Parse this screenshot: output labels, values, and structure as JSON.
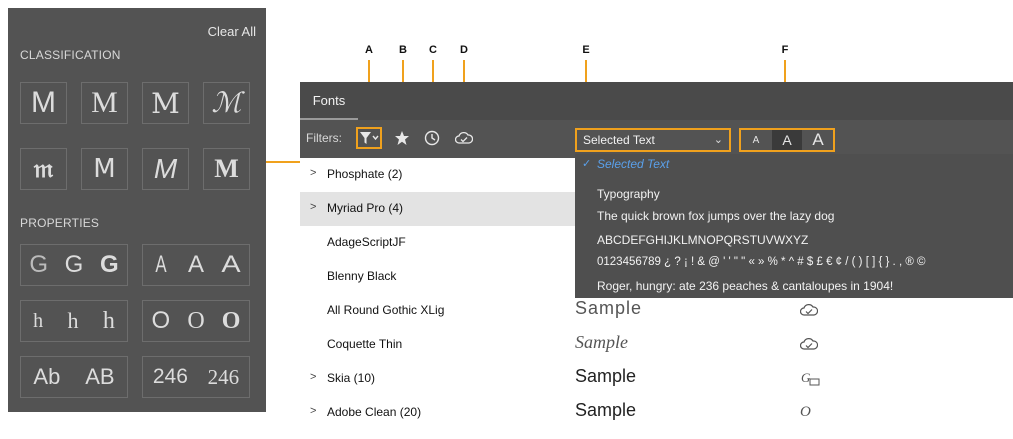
{
  "filter_panel": {
    "clear_all": "Clear All",
    "classification_title": "CLASSIFICATION",
    "classification_glyphs": [
      "M",
      "M",
      "M",
      "ℳ",
      "𝔪",
      "M",
      "M",
      "M"
    ],
    "properties_title": "PROPERTIES",
    "weight_glyphs": [
      "G",
      "G",
      "G"
    ],
    "width_glyphs": [
      "A",
      "A",
      "A"
    ],
    "xheight_glyphs": [
      "h",
      "h",
      "h"
    ],
    "contrast_glyphs": [
      "O",
      "O",
      "O"
    ],
    "case_glyphs": [
      "Ab",
      "AB"
    ],
    "number_glyphs": [
      "246",
      "246"
    ]
  },
  "annotations": [
    "A",
    "B",
    "C",
    "D",
    "E",
    "F"
  ],
  "fonts_panel": {
    "tab_label": "Fonts",
    "filters_label": "Filters:",
    "icons": [
      "filter-icon",
      "star-icon",
      "clock-icon",
      "cloud-sync-icon"
    ],
    "preview_select": {
      "value": "Selected Text",
      "chevron": "⌄"
    },
    "size_buttons": [
      "A",
      "A",
      "A"
    ],
    "fonts": [
      {
        "name": "Phosphate (2)",
        "expandable": true,
        "sample": "",
        "icon": ""
      },
      {
        "name": "Myriad Pro (4)",
        "expandable": true,
        "sample": "",
        "icon": ""
      },
      {
        "name": "AdageScriptJF",
        "expandable": false,
        "sample": "",
        "icon": ""
      },
      {
        "name": "Blenny Black",
        "expandable": false,
        "sample": "",
        "icon": ""
      },
      {
        "name": "All Round Gothic XLig",
        "expandable": false,
        "sample": "Sample",
        "icon": "☁"
      },
      {
        "name": "Coquette Thin",
        "expandable": false,
        "sample": "Sample",
        "icon": "☁"
      },
      {
        "name": "Skia (10)",
        "expandable": true,
        "sample": "Sample",
        "icon": "ɢ"
      },
      {
        "name": "Adobe Clean (20)",
        "expandable": true,
        "sample": "Sample",
        "icon": "O"
      }
    ]
  },
  "preview_dropdown": {
    "items": [
      "Selected Text",
      "Typography",
      "The quick brown fox jumps over the lazy dog",
      "ABCDEFGHIJKLMNOPQRSTUVWXYZ",
      "0123456789 ¿ ? ¡ ! & @ ' ' \" \" « » % * ^ # $ £ € ¢ / ( ) [ ] { } . , ® ©",
      "Roger, hungry: ate 236 peaches & cantaloupes in 1904!"
    ],
    "selected_index": 0
  },
  "colors": {
    "accent": "#f0a11d",
    "panel": "#535353",
    "header": "#4a4a4a",
    "dropdown": "#4f4f4f",
    "check": "#5aa0ea",
    "row_highlight": "#e3e3e3"
  }
}
